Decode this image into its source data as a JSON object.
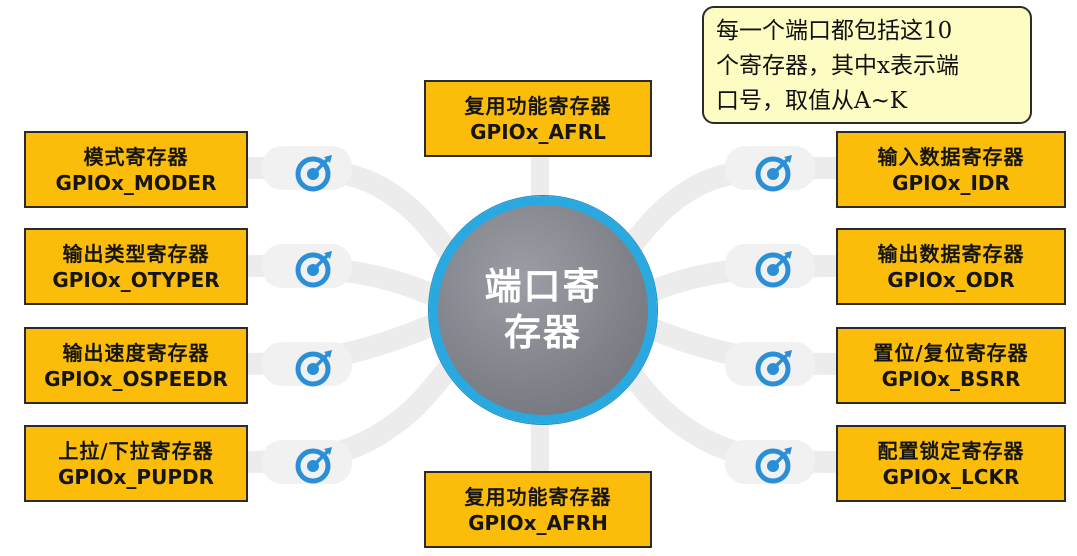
{
  "center": {
    "line1": "端口寄",
    "line2": "存器"
  },
  "note": {
    "line1": "每一个端口都包括这10",
    "line2": "个寄存器，其中x表示端",
    "line3": "口号，取值从A~K"
  },
  "registers": {
    "moder": {
      "cn": "模式寄存器",
      "en": "GPIOx_MODER"
    },
    "otyper": {
      "cn": "输出类型寄存器",
      "en": "GPIOx_OTYPER"
    },
    "ospeedr": {
      "cn": "输出速度寄存器",
      "en": "GPIOx_OSPEEDR"
    },
    "pupdr": {
      "cn": "上拉/下拉寄存器",
      "en": "GPIOx_PUPDR"
    },
    "afrl": {
      "cn": "复用功能寄存器",
      "en": "GPIOx_AFRL"
    },
    "afrh": {
      "cn": "复用功能寄存器",
      "en": "GPIOx_AFRH"
    },
    "idr": {
      "cn": "输入数据寄存器",
      "en": "GPIOx_IDR"
    },
    "odr": {
      "cn": "输出数据寄存器",
      "en": "GPIOx_ODR"
    },
    "bsrr": {
      "cn": "置位/复位寄存器",
      "en": "GPIOx_BSRR"
    },
    "lckr": {
      "cn": "配置锁定寄存器",
      "en": "GPIOx_LCKR"
    }
  },
  "colors": {
    "box_fill": "#fbbd0a",
    "circle_fill": "#808289",
    "circle_ring": "#2aa8e0",
    "note_fill": "#fdfcc2",
    "connector": "#eeeeee",
    "icon": "#2a8fd6"
  },
  "icons": {
    "target": "target-icon"
  }
}
